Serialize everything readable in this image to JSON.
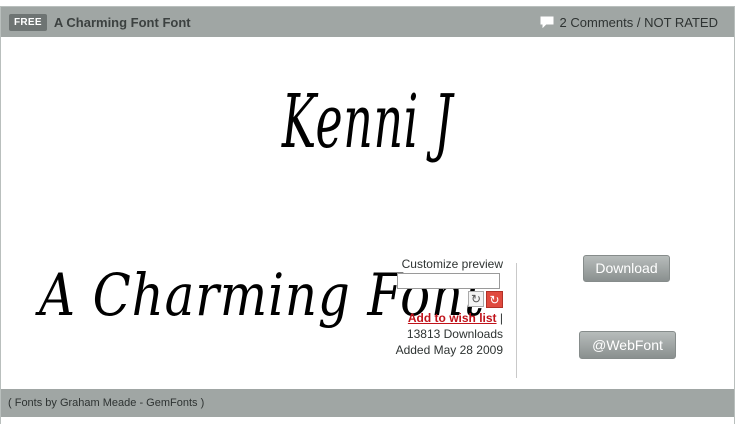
{
  "header": {
    "badge": "FREE",
    "title": "A Charming Font Font",
    "comments": "2 Comments",
    "separator": " / ",
    "rating": "NOT RATED"
  },
  "preview": {
    "text": "Kenni J"
  },
  "sample": {
    "text": "A Charming Font"
  },
  "customize": {
    "label": "Customize preview",
    "input_value": "",
    "wishlist": "Add to wish list",
    "wishlist_sep": " |",
    "downloads": "13813 Downloads",
    "added": "Added May 28 2009"
  },
  "buttons": {
    "download": "Download",
    "webfont": "@WebFont"
  },
  "footer": {
    "credits": "( Fonts by Graham Meade - GemFonts )"
  },
  "colors": {
    "bar": "#a0a6a4",
    "link": "#c0121a",
    "reset": "#e04a3e"
  }
}
